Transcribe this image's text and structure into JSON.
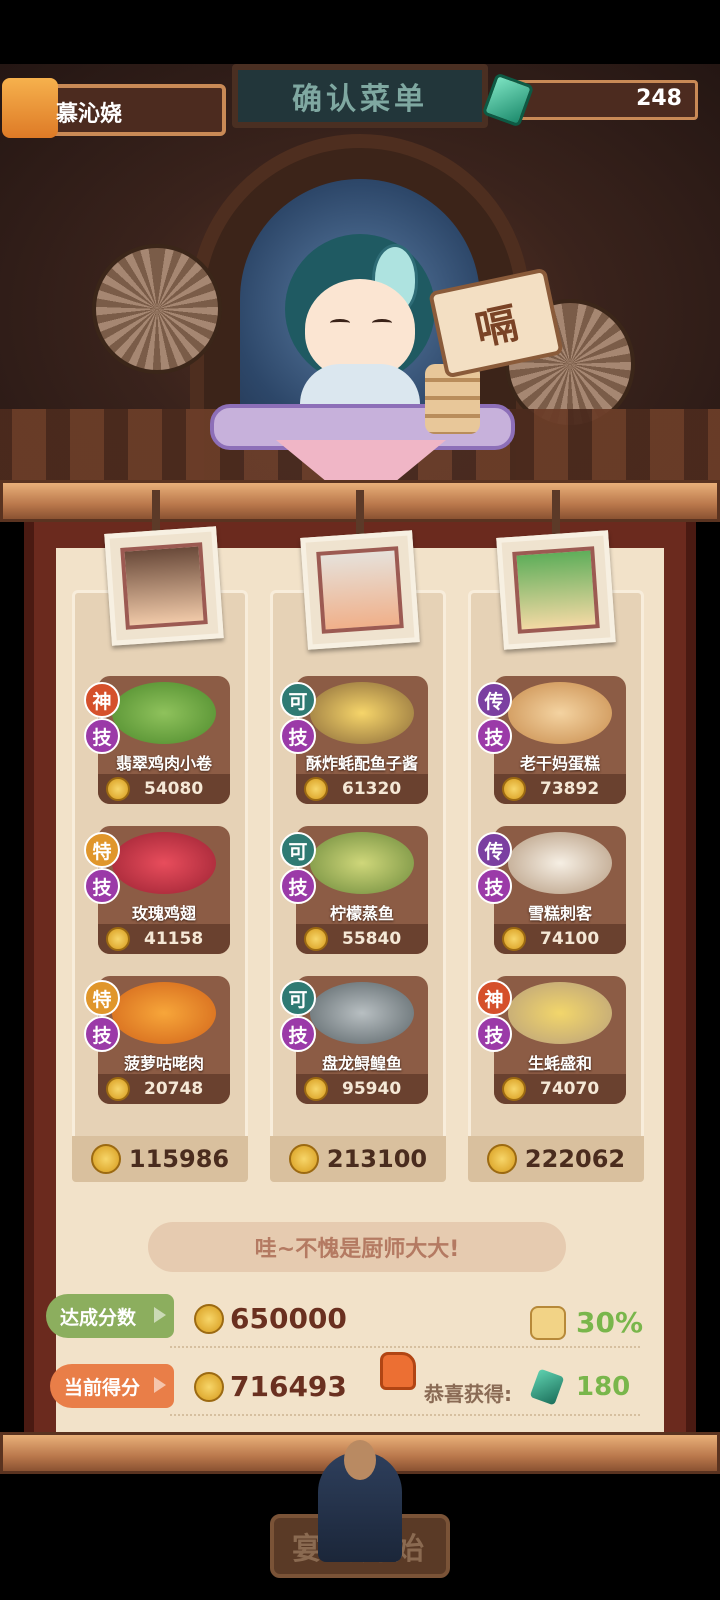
{
  "header": {
    "sign_title": "确认菜单",
    "player_name": "慕沁娆",
    "gem_count": "248",
    "speech_text": "嗝"
  },
  "columns": [
    {
      "chef_icon": "chef-portrait-boy",
      "dishes": [
        {
          "grade": "神",
          "skill": "技",
          "name": "翡翠鸡肉小卷",
          "price": "54080",
          "grade_color": "#d5502b"
        },
        {
          "grade": "特",
          "skill": "技",
          "name": "玫瑰鸡翅",
          "price": "41158",
          "grade_color": "#e0962b"
        },
        {
          "grade": "特",
          "skill": "技",
          "name": "菠萝咕咾肉",
          "price": "20748",
          "grade_color": "#e0962b"
        }
      ],
      "total": "115986"
    },
    {
      "chef_icon": "chef-portrait-silver-hair",
      "dishes": [
        {
          "grade": "可",
          "skill": "技",
          "name": "酥炸蚝配鱼子酱",
          "price": "61320",
          "grade_color": "#2f7a73"
        },
        {
          "grade": "可",
          "skill": "技",
          "name": "柠檬蒸鱼",
          "price": "55840",
          "grade_color": "#2f7a73"
        },
        {
          "grade": "可",
          "skill": "技",
          "name": "盘龙鲟鳇鱼",
          "price": "95940",
          "grade_color": "#2f7a73"
        }
      ],
      "total": "213100"
    },
    {
      "chef_icon": "chef-portrait-green-hair",
      "dishes": [
        {
          "grade": "传",
          "skill": "技",
          "name": "老干妈蛋糕",
          "price": "73892",
          "grade_color": "#7b3fa1"
        },
        {
          "grade": "传",
          "skill": "技",
          "name": "雪糕刺客",
          "price": "74100",
          "grade_color": "#7b3fa1"
        },
        {
          "grade": "神",
          "skill": "技",
          "name": "生蚝盛和",
          "price": "74070",
          "grade_color": "#d5502b"
        }
      ],
      "total": "222062"
    }
  ],
  "result": {
    "message": "哇~不愧是厨师大大!",
    "target_label": "达成分数",
    "target_score": "650000",
    "bonus_percent": "30%",
    "current_label": "当前得分",
    "current_score": "716493",
    "congrats_label": "恭喜获得:",
    "reward_gems": "180"
  },
  "start_button": "宴会开始"
}
